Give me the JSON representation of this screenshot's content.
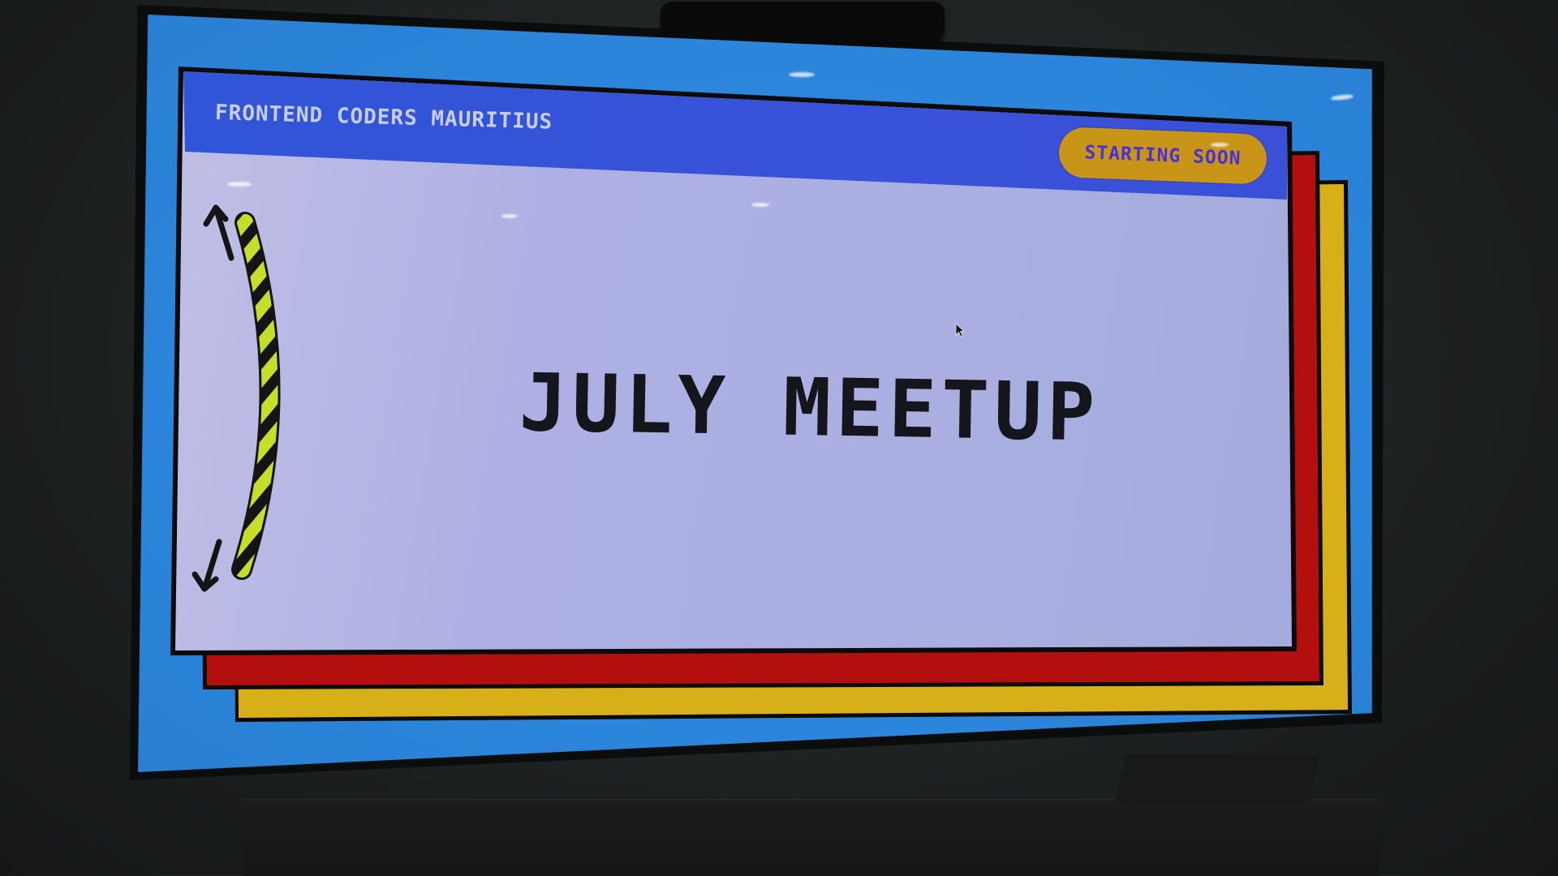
{
  "slide": {
    "group_name": "FRONTEND CODERS MAURITIUS",
    "status": "STARTING SOON",
    "title": "JULY MEETUP"
  },
  "colors": {
    "screen_background": "#3b97ea",
    "header_bar": "#2f56d7",
    "card_back_red": "#b40f0f",
    "card_back_yellow": "#d7b019",
    "card_face": "#b0b2e4",
    "status_pill": "#c99519",
    "status_text": "#4a30d9",
    "title_text": "#15151c"
  },
  "icons": [
    "hazard-stripe-arc",
    "arrow-up-icon",
    "arrow-down-icon",
    "mouse-cursor-icon"
  ]
}
